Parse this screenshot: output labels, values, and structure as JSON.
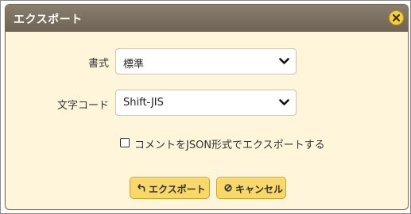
{
  "dialog": {
    "title": "エクスポート",
    "close_icon": "close-icon"
  },
  "form": {
    "format": {
      "label": "書式",
      "value": "標準"
    },
    "encoding": {
      "label": "文字コード",
      "value": "Shift-JIS"
    },
    "json_comments": {
      "label": "コメントをJSON形式でエクスポートする",
      "checked": false
    }
  },
  "buttons": {
    "export": {
      "label": "エクスポート",
      "icon": "undo-arrow-icon"
    },
    "cancel": {
      "label": "キャンセル",
      "icon": "no-entry-icon"
    }
  },
  "colors": {
    "titlebar": "#7f7465",
    "dialog_bg": "#fff5db",
    "button_bg": "#f9d86a",
    "close_bg": "#f7cf3a"
  }
}
